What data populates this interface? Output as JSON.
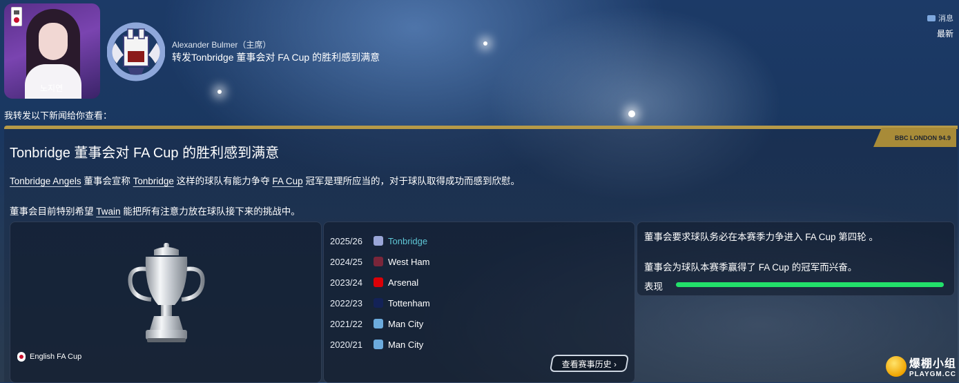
{
  "inbox": {
    "label": "消息",
    "latest": "最新"
  },
  "message": {
    "sender": "Alexander Bulmer（主席）",
    "subject": "转发Tonbridge 董事会对 FA Cup 的胜利感到满意",
    "forward_note": "我转发以下新闻给你查看：",
    "avatar_signature": "노지연"
  },
  "news": {
    "source": "BBC LONDON 94.9",
    "title": "Tonbridge 董事会对 FA Cup 的胜利感到满意",
    "p1": {
      "club_full": "Tonbridge Angels",
      "t1": " 董事会宣称 ",
      "club": "Tonbridge",
      "t2": " 这样的球队有能力争夺 ",
      "comp": "FA Cup",
      "t3": " 冠军是理所应当的，对于球队取得成功而感到欣慰。"
    },
    "p2": {
      "t1": "董事会目前特别希望 ",
      "manager": "Twain",
      "t2": " 能把所有注意力放在球队接下来的挑战中。"
    }
  },
  "competition": {
    "name": "English FA Cup"
  },
  "history": {
    "rows": [
      {
        "season": "2025/26",
        "team": "Tonbridge",
        "color": "#9aa6d8",
        "link": true
      },
      {
        "season": "2024/25",
        "team": "West Ham",
        "color": "#7a263a",
        "link": false
      },
      {
        "season": "2023/24",
        "team": "Arsenal",
        "color": "#db0007",
        "link": false
      },
      {
        "season": "2022/23",
        "team": "Tottenham",
        "color": "#132257",
        "link": false
      },
      {
        "season": "2021/22",
        "team": "Man City",
        "color": "#6cabdd",
        "link": false
      },
      {
        "season": "2020/21",
        "team": "Man City",
        "color": "#6cabdd",
        "link": false
      }
    ],
    "view_button": "查看赛事历史"
  },
  "expectation": {
    "line1": "董事会要求球队务必在本赛季力争进入 FA Cup 第四轮 。",
    "line2": "董事会为球队本赛季赢得了 FA Cup 的冠军而兴奋。",
    "performance_label": "表现",
    "performance_value": 1.0,
    "performance_color": "#22e06a"
  },
  "watermark": {
    "cn": "爆棚小组",
    "en": "PLAYGM.CC"
  }
}
